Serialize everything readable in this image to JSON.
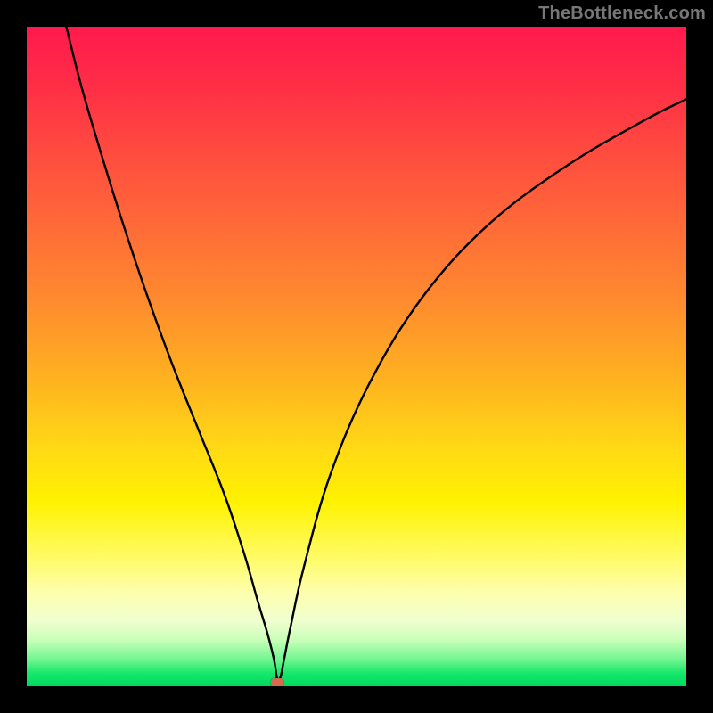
{
  "watermark": "TheBottleneck.com",
  "chart_data": {
    "type": "line",
    "title": "",
    "xlabel": "",
    "ylabel": "",
    "xlim": [
      0,
      100
    ],
    "ylim": [
      0,
      100
    ],
    "grid": false,
    "legend": false,
    "series": [
      {
        "name": "curve",
        "x": [
          6,
          8,
          10,
          14,
          18,
          22,
          26,
          30,
          33,
          35,
          36.5,
          37.5,
          38,
          38.5,
          39,
          40,
          42,
          46,
          52,
          60,
          70,
          82,
          94,
          100
        ],
        "y": [
          100,
          92,
          85,
          72,
          60,
          49,
          39,
          29,
          20,
          13,
          8,
          4,
          1,
          1.5,
          4,
          9,
          18,
          32,
          46,
          59,
          70,
          79,
          86,
          89
        ]
      }
    ],
    "marker": {
      "x": 38,
      "y": 0.5
    },
    "background_gradient": {
      "type": "vertical",
      "stops": [
        {
          "pos": 0,
          "color": "#ff1a4d"
        },
        {
          "pos": 30,
          "color": "#ff6a38"
        },
        {
          "pos": 64,
          "color": "#ffd916"
        },
        {
          "pos": 86,
          "color": "#fdffb0"
        },
        {
          "pos": 100,
          "color": "#00d860"
        }
      ]
    }
  }
}
